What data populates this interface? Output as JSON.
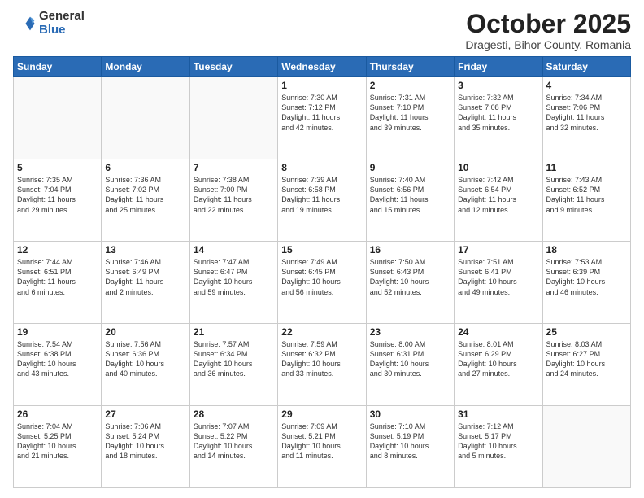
{
  "header": {
    "logo_general": "General",
    "logo_blue": "Blue",
    "month_title": "October 2025",
    "location": "Dragesti, Bihor County, Romania"
  },
  "columns": [
    "Sunday",
    "Monday",
    "Tuesday",
    "Wednesday",
    "Thursday",
    "Friday",
    "Saturday"
  ],
  "weeks": [
    [
      {
        "day": "",
        "text": ""
      },
      {
        "day": "",
        "text": ""
      },
      {
        "day": "",
        "text": ""
      },
      {
        "day": "1",
        "text": "Sunrise: 7:30 AM\nSunset: 7:12 PM\nDaylight: 11 hours\nand 42 minutes."
      },
      {
        "day": "2",
        "text": "Sunrise: 7:31 AM\nSunset: 7:10 PM\nDaylight: 11 hours\nand 39 minutes."
      },
      {
        "day": "3",
        "text": "Sunrise: 7:32 AM\nSunset: 7:08 PM\nDaylight: 11 hours\nand 35 minutes."
      },
      {
        "day": "4",
        "text": "Sunrise: 7:34 AM\nSunset: 7:06 PM\nDaylight: 11 hours\nand 32 minutes."
      }
    ],
    [
      {
        "day": "5",
        "text": "Sunrise: 7:35 AM\nSunset: 7:04 PM\nDaylight: 11 hours\nand 29 minutes."
      },
      {
        "day": "6",
        "text": "Sunrise: 7:36 AM\nSunset: 7:02 PM\nDaylight: 11 hours\nand 25 minutes."
      },
      {
        "day": "7",
        "text": "Sunrise: 7:38 AM\nSunset: 7:00 PM\nDaylight: 11 hours\nand 22 minutes."
      },
      {
        "day": "8",
        "text": "Sunrise: 7:39 AM\nSunset: 6:58 PM\nDaylight: 11 hours\nand 19 minutes."
      },
      {
        "day": "9",
        "text": "Sunrise: 7:40 AM\nSunset: 6:56 PM\nDaylight: 11 hours\nand 15 minutes."
      },
      {
        "day": "10",
        "text": "Sunrise: 7:42 AM\nSunset: 6:54 PM\nDaylight: 11 hours\nand 12 minutes."
      },
      {
        "day": "11",
        "text": "Sunrise: 7:43 AM\nSunset: 6:52 PM\nDaylight: 11 hours\nand 9 minutes."
      }
    ],
    [
      {
        "day": "12",
        "text": "Sunrise: 7:44 AM\nSunset: 6:51 PM\nDaylight: 11 hours\nand 6 minutes."
      },
      {
        "day": "13",
        "text": "Sunrise: 7:46 AM\nSunset: 6:49 PM\nDaylight: 11 hours\nand 2 minutes."
      },
      {
        "day": "14",
        "text": "Sunrise: 7:47 AM\nSunset: 6:47 PM\nDaylight: 10 hours\nand 59 minutes."
      },
      {
        "day": "15",
        "text": "Sunrise: 7:49 AM\nSunset: 6:45 PM\nDaylight: 10 hours\nand 56 minutes."
      },
      {
        "day": "16",
        "text": "Sunrise: 7:50 AM\nSunset: 6:43 PM\nDaylight: 10 hours\nand 52 minutes."
      },
      {
        "day": "17",
        "text": "Sunrise: 7:51 AM\nSunset: 6:41 PM\nDaylight: 10 hours\nand 49 minutes."
      },
      {
        "day": "18",
        "text": "Sunrise: 7:53 AM\nSunset: 6:39 PM\nDaylight: 10 hours\nand 46 minutes."
      }
    ],
    [
      {
        "day": "19",
        "text": "Sunrise: 7:54 AM\nSunset: 6:38 PM\nDaylight: 10 hours\nand 43 minutes."
      },
      {
        "day": "20",
        "text": "Sunrise: 7:56 AM\nSunset: 6:36 PM\nDaylight: 10 hours\nand 40 minutes."
      },
      {
        "day": "21",
        "text": "Sunrise: 7:57 AM\nSunset: 6:34 PM\nDaylight: 10 hours\nand 36 minutes."
      },
      {
        "day": "22",
        "text": "Sunrise: 7:59 AM\nSunset: 6:32 PM\nDaylight: 10 hours\nand 33 minutes."
      },
      {
        "day": "23",
        "text": "Sunrise: 8:00 AM\nSunset: 6:31 PM\nDaylight: 10 hours\nand 30 minutes."
      },
      {
        "day": "24",
        "text": "Sunrise: 8:01 AM\nSunset: 6:29 PM\nDaylight: 10 hours\nand 27 minutes."
      },
      {
        "day": "25",
        "text": "Sunrise: 8:03 AM\nSunset: 6:27 PM\nDaylight: 10 hours\nand 24 minutes."
      }
    ],
    [
      {
        "day": "26",
        "text": "Sunrise: 7:04 AM\nSunset: 5:25 PM\nDaylight: 10 hours\nand 21 minutes."
      },
      {
        "day": "27",
        "text": "Sunrise: 7:06 AM\nSunset: 5:24 PM\nDaylight: 10 hours\nand 18 minutes."
      },
      {
        "day": "28",
        "text": "Sunrise: 7:07 AM\nSunset: 5:22 PM\nDaylight: 10 hours\nand 14 minutes."
      },
      {
        "day": "29",
        "text": "Sunrise: 7:09 AM\nSunset: 5:21 PM\nDaylight: 10 hours\nand 11 minutes."
      },
      {
        "day": "30",
        "text": "Sunrise: 7:10 AM\nSunset: 5:19 PM\nDaylight: 10 hours\nand 8 minutes."
      },
      {
        "day": "31",
        "text": "Sunrise: 7:12 AM\nSunset: 5:17 PM\nDaylight: 10 hours\nand 5 minutes."
      },
      {
        "day": "",
        "text": ""
      }
    ]
  ]
}
